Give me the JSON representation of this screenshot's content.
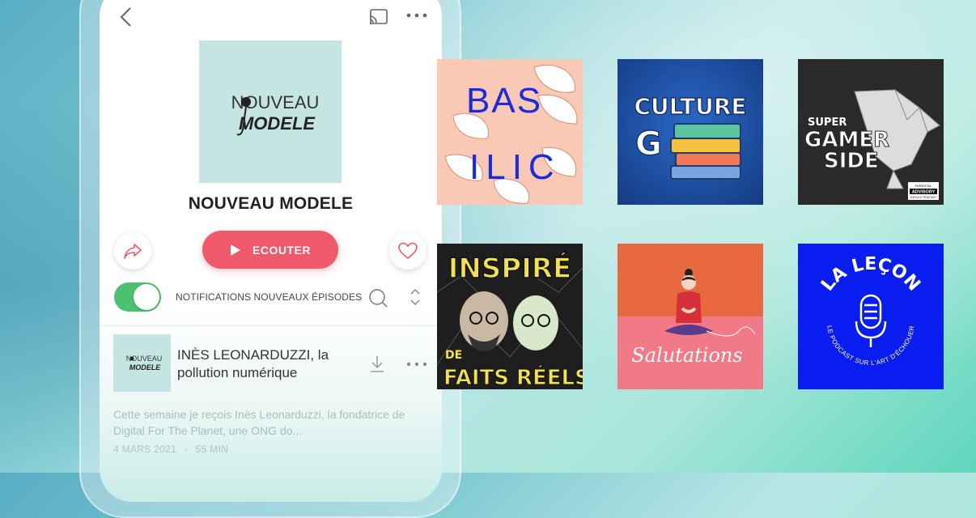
{
  "player": {
    "podcast_title": "NOUVEAU MODELE",
    "cover_logo_line1": "NOUVEAU",
    "cover_logo_line2": "MODELE",
    "listen_label": "ECOUTER",
    "notifications_label": "NOTIFICATIONS NOUVEAUX ÉPISODES",
    "notifications_on": true,
    "episode": {
      "title": "INÈS LEONARDUZZI, la pollution numérique",
      "description": "Cette semaine je reçois Inès Leonarduzzi, la fondatrice de Digital For The Planet, une ONG do...",
      "date": "4 MARS 2021",
      "separator": "·",
      "duration": "55 MIN"
    }
  },
  "covers": [
    {
      "name": "basilic",
      "text_line1": "BAS",
      "text_line2": "ILIC",
      "bg": "#f9c9b6",
      "fg": "#1b2be0"
    },
    {
      "name": "culture-g",
      "text_line1": "CULTURE",
      "text_line2": "G",
      "bg": "#1f4a9a",
      "fg": "#ffffff"
    },
    {
      "name": "super-gamer-side",
      "text_line1": "SUPER",
      "text_line2": "GAMER",
      "text_line3": "SIDE",
      "badge_line1": "PARENTAL",
      "badge_line2": "ADVISORY",
      "badge_line3": "EXPLICIT PODCAST",
      "bg": "#2a2a2a",
      "fg": "#ffffff"
    },
    {
      "name": "inspire-de-faits-reels",
      "text_line1": "INSPIRÉ",
      "text_line2": "DE",
      "text_line3": "FAITS",
      "text_line4": "RÉELS",
      "bg": "#1e1e1e",
      "fg": "#f3e34a"
    },
    {
      "name": "salutations",
      "text_line1": "Salutations",
      "bg_top": "#e8693f",
      "bg_bottom": "#f27a86"
    },
    {
      "name": "la-lecon",
      "text_line1": "LA LEÇON",
      "text_line2": "LE PODCAST SUR L'ART D'ÉCHOUER",
      "bg": "#0a1df0",
      "fg": "#ffffff"
    }
  ],
  "colors": {
    "accent": "#ef5a6a",
    "toggle_on": "#4cc270",
    "cover_mint": "#c4e5e1"
  }
}
